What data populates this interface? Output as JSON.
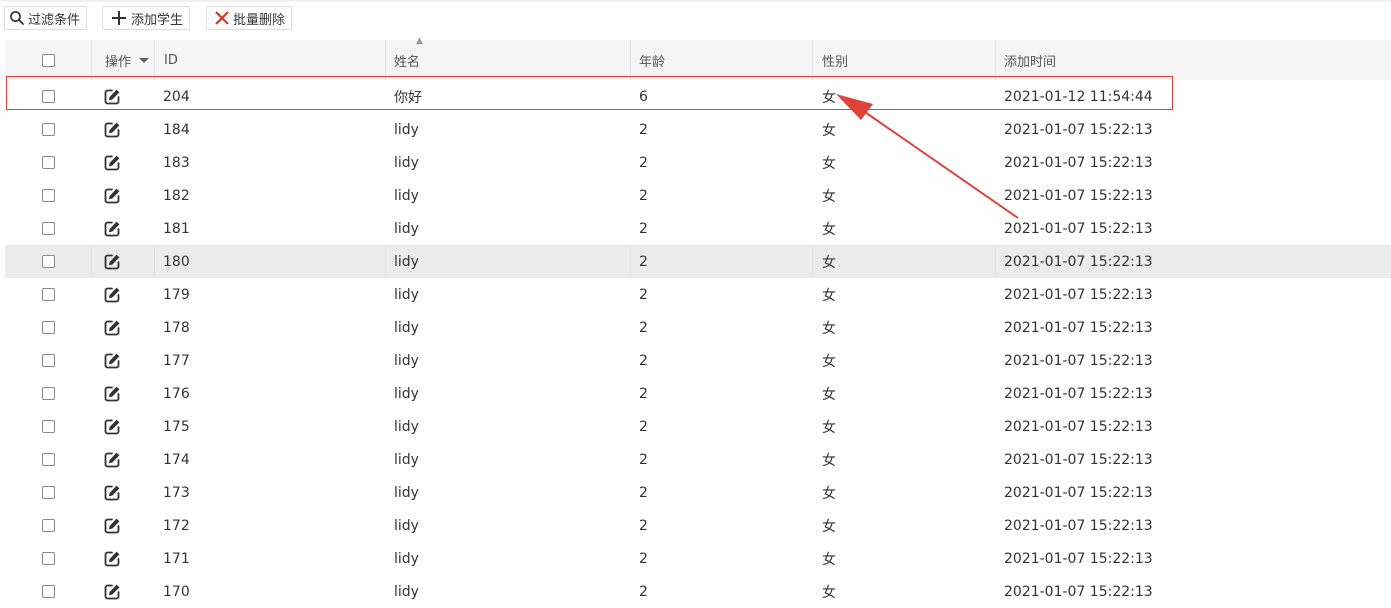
{
  "toolbar": {
    "filter_label": "过滤条件",
    "add_label": "添加学生",
    "batch_delete_label": "批量删除"
  },
  "table": {
    "columns": [
      "操作",
      "ID",
      "姓名",
      "年龄",
      "性别",
      "添加时间"
    ],
    "rows": [
      {
        "id": "204",
        "name": "你好",
        "age": "6",
        "sex": "女",
        "time": "2021-01-12 11:54:44"
      },
      {
        "id": "184",
        "name": "lidy",
        "age": "2",
        "sex": "女",
        "time": "2021-01-07 15:22:13"
      },
      {
        "id": "183",
        "name": "lidy",
        "age": "2",
        "sex": "女",
        "time": "2021-01-07 15:22:13"
      },
      {
        "id": "182",
        "name": "lidy",
        "age": "2",
        "sex": "女",
        "time": "2021-01-07 15:22:13"
      },
      {
        "id": "181",
        "name": "lidy",
        "age": "2",
        "sex": "女",
        "time": "2021-01-07 15:22:13"
      },
      {
        "id": "180",
        "name": "lidy",
        "age": "2",
        "sex": "女",
        "time": "2021-01-07 15:22:13"
      },
      {
        "id": "179",
        "name": "lidy",
        "age": "2",
        "sex": "女",
        "time": "2021-01-07 15:22:13"
      },
      {
        "id": "178",
        "name": "lidy",
        "age": "2",
        "sex": "女",
        "time": "2021-01-07 15:22:13"
      },
      {
        "id": "177",
        "name": "lidy",
        "age": "2",
        "sex": "女",
        "time": "2021-01-07 15:22:13"
      },
      {
        "id": "176",
        "name": "lidy",
        "age": "2",
        "sex": "女",
        "time": "2021-01-07 15:22:13"
      },
      {
        "id": "175",
        "name": "lidy",
        "age": "2",
        "sex": "女",
        "time": "2021-01-07 15:22:13"
      },
      {
        "id": "174",
        "name": "lidy",
        "age": "2",
        "sex": "女",
        "time": "2021-01-07 15:22:13"
      },
      {
        "id": "173",
        "name": "lidy",
        "age": "2",
        "sex": "女",
        "time": "2021-01-07 15:22:13"
      },
      {
        "id": "172",
        "name": "lidy",
        "age": "2",
        "sex": "女",
        "time": "2021-01-07 15:22:13"
      },
      {
        "id": "171",
        "name": "lidy",
        "age": "2",
        "sex": "女",
        "time": "2021-01-07 15:22:13"
      },
      {
        "id": "170",
        "name": "lidy",
        "age": "2",
        "sex": "女",
        "time": "2021-01-07 15:22:13"
      }
    ],
    "hovered_row_index": 5
  },
  "icons": {
    "filter": "search-icon",
    "add": "plus-icon",
    "delete": "close-icon",
    "edit": "edit-icon",
    "column_menu": "caret-down-icon"
  },
  "colors": {
    "annotation": "#e0413a",
    "delete_icon": "#d9342b",
    "header_bg": "#f5f5f5",
    "hover_row_bg": "#ececec"
  }
}
